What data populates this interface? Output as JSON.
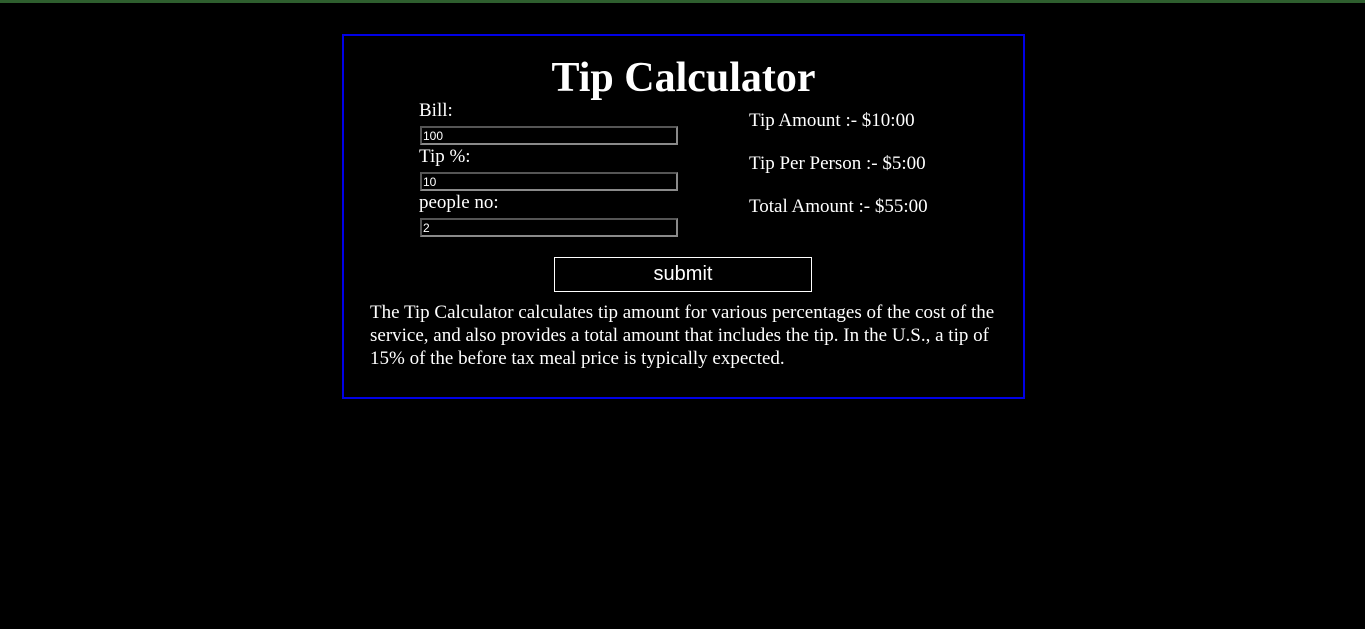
{
  "page": {
    "title": "Tip Calculator",
    "colors": {
      "background": "#000000",
      "box_border": "#0000e6",
      "text": "#ffffff",
      "top_strip": "#2e5e2e"
    }
  },
  "form": {
    "bill_label": "Bill:",
    "bill_value": "100",
    "tip_label": "Tip %:",
    "tip_value": "10",
    "people_label": "people no:",
    "people_value": "2",
    "submit_label": "submit"
  },
  "results": {
    "tip_amount": "Tip Amount :- $10:00",
    "tip_per_person": "Tip Per Person :- $5:00",
    "total_amount": "Total Amount :- $55:00"
  },
  "description": "The Tip Calculator calculates tip amount for various percentages of the cost of the service, and also provides a total amount that includes the tip. In the U.S., a tip of 15% of the before tax meal price is typically expected."
}
